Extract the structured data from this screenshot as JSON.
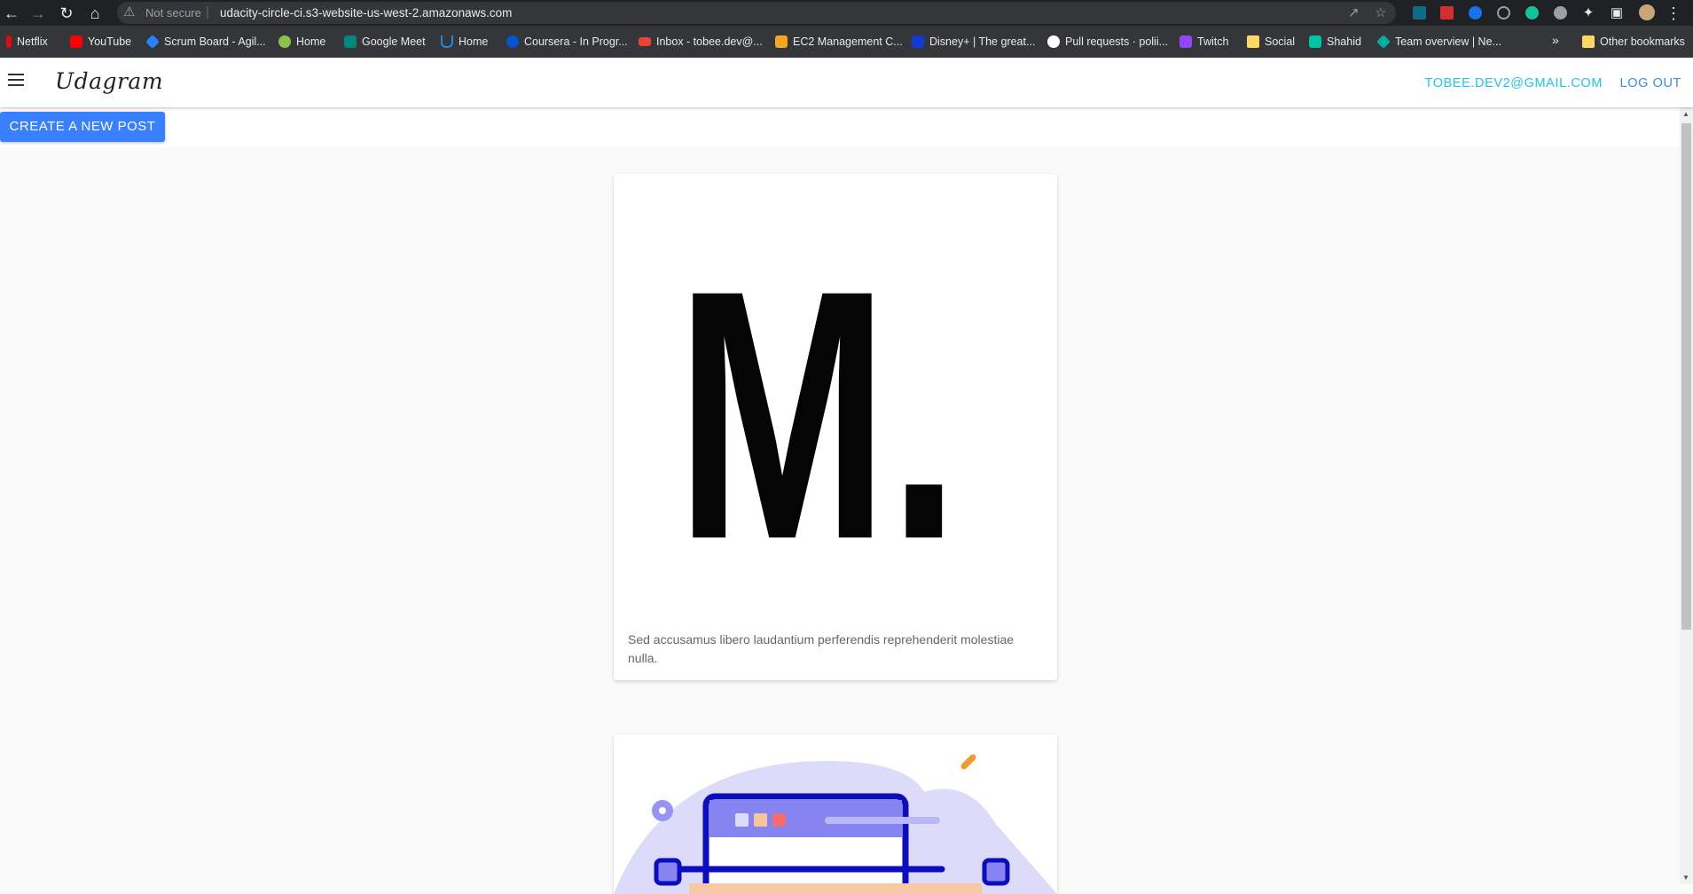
{
  "browser": {
    "security_label": "Not secure",
    "url": "udacity-circle-ci.s3-website-us-west-2.amazonaws.com",
    "icons": [
      "back-icon",
      "forward-icon",
      "reload-icon",
      "home-icon",
      "warning-icon",
      "share-icon",
      "star-icon",
      "puzzle-icon",
      "side-panel-icon",
      "kebab-menu-icon"
    ]
  },
  "bookmarks": {
    "items": [
      {
        "label": "Netflix",
        "color": "#e50914"
      },
      {
        "label": "YouTube",
        "color": "#ff0000"
      },
      {
        "label": "Scrum Board - Agil...",
        "color": "#2684ff"
      },
      {
        "label": "Home",
        "color": "#8bc34a"
      },
      {
        "label": "Google Meet",
        "color": "#00897b"
      },
      {
        "label": "Home",
        "color": "#1e88e5"
      },
      {
        "label": "Coursera - In Progr...",
        "color": "#0056d2"
      },
      {
        "label": "Inbox - tobee.dev@...",
        "color": "#ea4335"
      },
      {
        "label": "EC2 Management C...",
        "color": "#f5a623"
      },
      {
        "label": "Disney+ | The great...",
        "color": "#113ccf"
      },
      {
        "label": "Pull requests · polii...",
        "color": "#ffffff"
      },
      {
        "label": "Twitch",
        "color": "#9146ff"
      },
      {
        "label": "Social",
        "color": "#fdd663"
      },
      {
        "label": "Shahid",
        "color": "#00c4a7"
      },
      {
        "label": "Team overview | Ne...",
        "color": "#00ad9f"
      }
    ],
    "other_label": "Other bookmarks"
  },
  "header": {
    "brand": "Udagram",
    "user_email": "TOBEE.DEV2@GMAIL.COM",
    "logout_label": "LOG OUT"
  },
  "toolbar": {
    "create_label": "CREATE A NEW POST"
  },
  "feed": {
    "posts": [
      {
        "image_text": "M.",
        "caption": "Sed accusamus libero laudantium perferendis reprehenderit molestiae nulla."
      }
    ]
  }
}
